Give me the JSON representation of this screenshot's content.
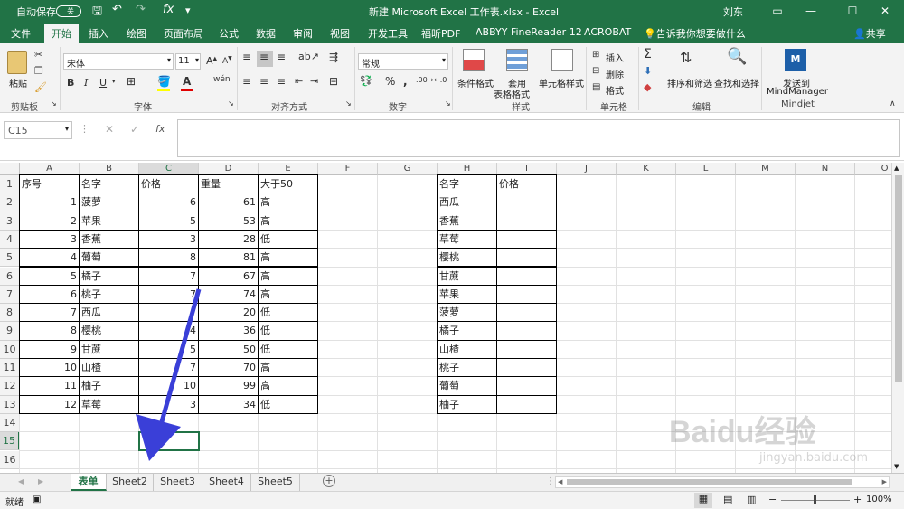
{
  "titlebar": {
    "autosave": "自动保存",
    "toggle": "关",
    "title": "新建 Microsoft Excel 工作表.xlsx  -  Excel",
    "user": "刘东"
  },
  "tabs": [
    "文件",
    "开始",
    "插入",
    "绘图",
    "页面布局",
    "公式",
    "数据",
    "审阅",
    "视图",
    "开发工具",
    "福昕PDF",
    "ABBYY FineReader 12",
    "ACROBAT"
  ],
  "tell_me": "告诉我你想要做什么",
  "share": "共享",
  "ribbon": {
    "paste": "粘贴",
    "clipboard": "剪贴板",
    "font_name": "宋体",
    "font_size": "11",
    "font_group": "字体",
    "align_group": "对齐方式",
    "number_format": "常规",
    "number_group": "数字",
    "cond_format": "条件格式",
    "table_format_1": "套用",
    "table_format_2": "表格格式",
    "cell_style": "单元格样式",
    "styles_group": "样式",
    "insert": "插入",
    "delete": "删除",
    "format": "格式",
    "cells_group": "单元格",
    "sort_filter": "排序和筛选",
    "find_select": "查找和选择",
    "editing_group": "编辑",
    "send_to_1": "发送到",
    "send_to_2": "MindManager",
    "mindjet_group": "Mindjet"
  },
  "formula_bar": {
    "name_box": "C15",
    "fx": "fx",
    "value": ""
  },
  "columns": [
    "A",
    "B",
    "C",
    "D",
    "E",
    "F",
    "G",
    "H",
    "I",
    "J",
    "K",
    "L",
    "M",
    "N",
    "O"
  ],
  "rows": [
    "1",
    "2",
    "3",
    "4",
    "5",
    "6",
    "7",
    "8",
    "9",
    "10",
    "11",
    "12",
    "13",
    "14",
    "15",
    "16"
  ],
  "table1": {
    "headers": [
      "序号",
      "名字",
      "价格",
      "重量",
      "大于50"
    ],
    "rows": [
      [
        "1",
        "菠萝",
        "6",
        "61",
        "高"
      ],
      [
        "2",
        "苹果",
        "5",
        "53",
        "高"
      ],
      [
        "3",
        "香蕉",
        "3",
        "28",
        "低"
      ],
      [
        "4",
        "葡萄",
        "8",
        "81",
        "高"
      ],
      [
        "5",
        "橘子",
        "7",
        "67",
        "高"
      ],
      [
        "6",
        "桃子",
        "7",
        "74",
        "高"
      ],
      [
        "7",
        "西瓜",
        "",
        "20",
        "低"
      ],
      [
        "8",
        "樱桃",
        "4",
        "36",
        "低"
      ],
      [
        "9",
        "甘蔗",
        "5",
        "50",
        "低"
      ],
      [
        "10",
        "山楂",
        "7",
        "70",
        "高"
      ],
      [
        "11",
        "柚子",
        "10",
        "99",
        "高"
      ],
      [
        "12",
        "草莓",
        "3",
        "34",
        "低"
      ]
    ]
  },
  "table2": {
    "headers": [
      "名字",
      "价格"
    ],
    "names": [
      "西瓜",
      "香蕉",
      "草莓",
      "樱桃",
      "甘蔗",
      "苹果",
      "菠萝",
      "橘子",
      "山楂",
      "桃子",
      "葡萄",
      "柚子"
    ]
  },
  "sheets": [
    "表单",
    "Sheet2",
    "Sheet3",
    "Sheet4",
    "Sheet5"
  ],
  "status": {
    "ready": "就绪",
    "zoom": "100%"
  },
  "watermark": {
    "brand": "Baidu经验",
    "url": "jingyan.baidu.com"
  },
  "colors": {
    "excel_green": "#217346",
    "arrow": "#3a3fd8"
  }
}
